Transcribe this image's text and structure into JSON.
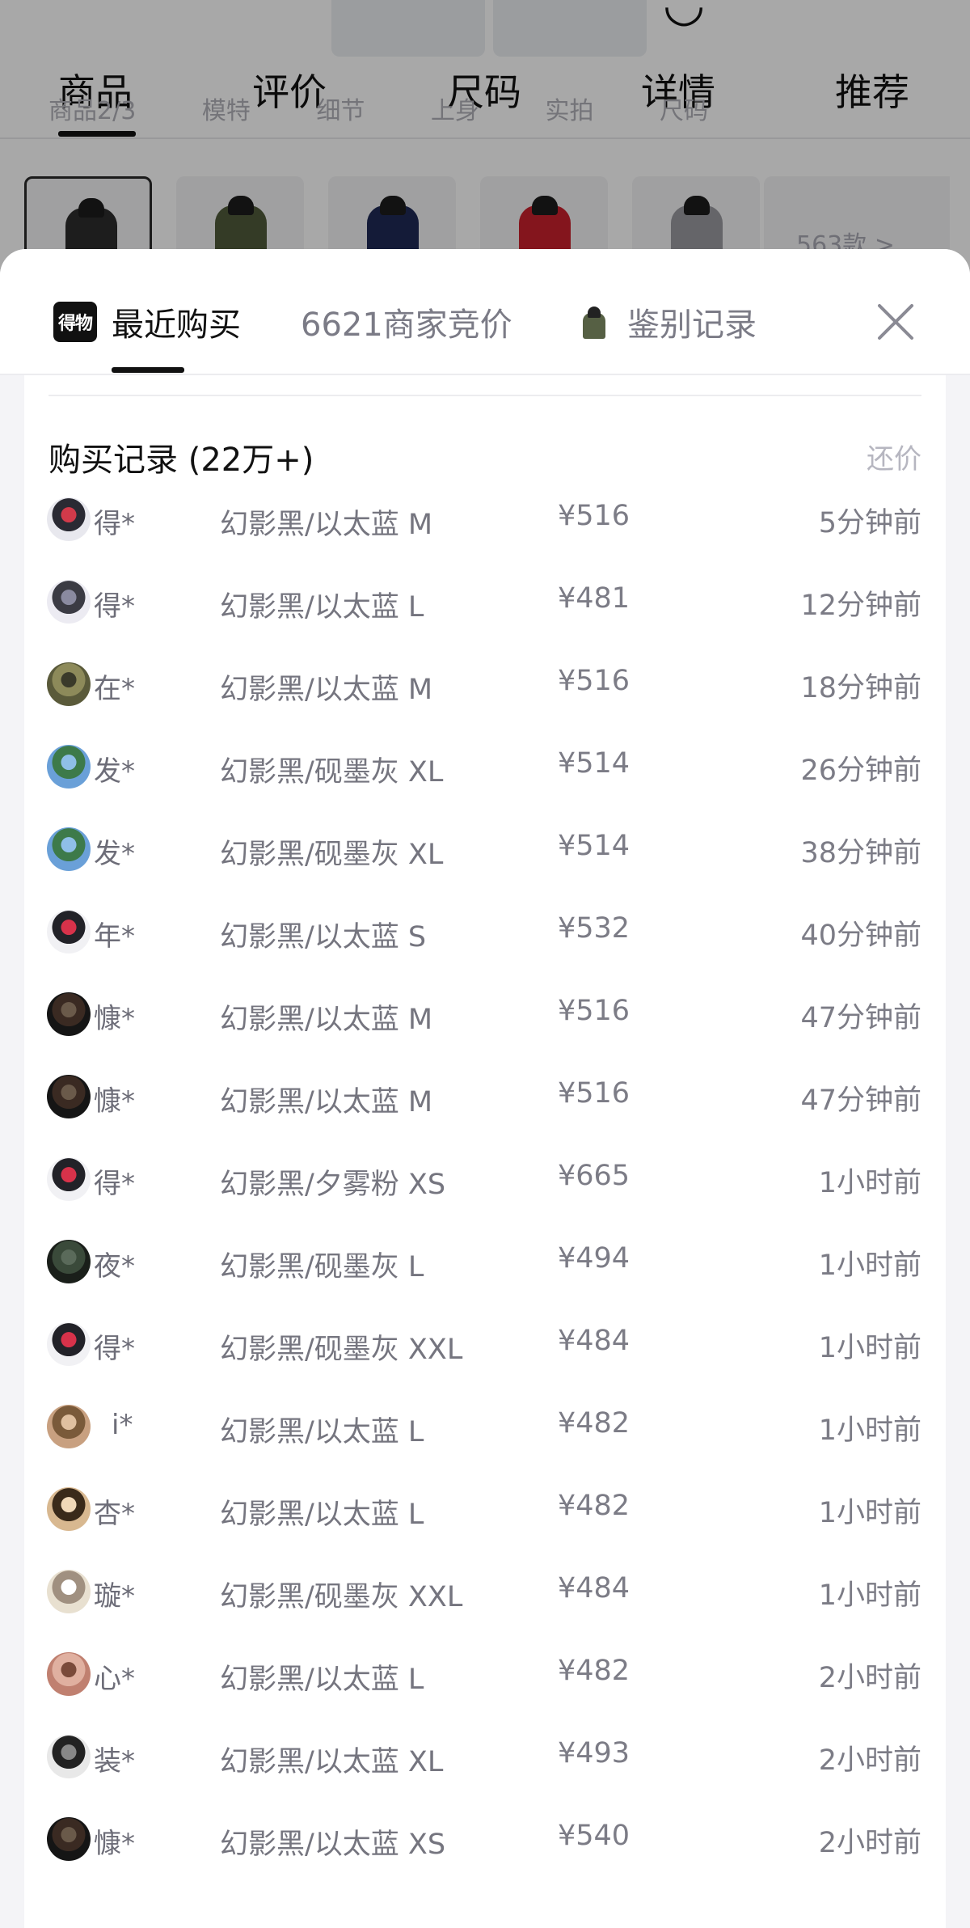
{
  "background": {
    "tabs": [
      "商品",
      "评价",
      "尺码",
      "详情",
      "推荐"
    ],
    "active_tab": "商品",
    "subtabs": [
      "商品2/3",
      "模特",
      "细节",
      "上身",
      "实拍",
      "尺码"
    ],
    "thumb_colors": [
      "#2c2c2c",
      "#4f5a3a",
      "#1f2a55",
      "#c9202c",
      "#9a9aa0"
    ],
    "more_label": "563款 >"
  },
  "sheet": {
    "logo_text": "得物",
    "tabs": [
      {
        "label": "最近购买",
        "active": true
      },
      {
        "label": "6621商家竞价",
        "active": false
      },
      {
        "label": "鉴别记录",
        "active": false
      }
    ],
    "close_icon": "close-icon",
    "section_title": "购买记录 (22万+)",
    "action_link": "还价",
    "records": [
      {
        "user": "得*",
        "spec": "幻影黑/以太蓝 M",
        "price": "¥516",
        "time": "5分钟前",
        "avatar": [
          "#e8e8ee",
          "#2a2a33",
          "#d23a4a"
        ]
      },
      {
        "user": "得*",
        "spec": "幻影黑/以太蓝 L",
        "price": "¥481",
        "time": "12分钟前",
        "avatar": [
          "#ecebf2",
          "#3b3b44",
          "#8a8aa0"
        ]
      },
      {
        "user": "在*",
        "spec": "幻影黑/以太蓝 M",
        "price": "¥516",
        "time": "18分钟前",
        "avatar": [
          "#5a5a3a",
          "#8d8a5a",
          "#3a3a2a"
        ]
      },
      {
        "user": "发*",
        "spec": "幻影黑/砚墨灰 XL",
        "price": "¥514",
        "time": "26分钟前",
        "avatar": [
          "#6aa0d8",
          "#3d7a4a",
          "#8fbfe8"
        ]
      },
      {
        "user": "发*",
        "spec": "幻影黑/砚墨灰 XL",
        "price": "¥514",
        "time": "38分钟前",
        "avatar": [
          "#6aa0d8",
          "#3d7a4a",
          "#8fbfe8"
        ]
      },
      {
        "user": "年*",
        "spec": "幻影黑/以太蓝 S",
        "price": "¥532",
        "time": "40分钟前",
        "avatar": [
          "#f1f1f4",
          "#222228",
          "#d8324a"
        ]
      },
      {
        "user": "慷*",
        "spec": "幻影黑/以太蓝 M",
        "price": "¥516",
        "time": "47分钟前",
        "avatar": [
          "#151515",
          "#3a2a22",
          "#6a5a4a"
        ]
      },
      {
        "user": "慷*",
        "spec": "幻影黑/以太蓝 M",
        "price": "¥516",
        "time": "47分钟前",
        "avatar": [
          "#151515",
          "#3a2a22",
          "#6a5a4a"
        ]
      },
      {
        "user": "得*",
        "spec": "幻影黑/夕雾粉 XS",
        "price": "¥665",
        "time": "1小时前",
        "avatar": [
          "#f1f1f4",
          "#222228",
          "#d8324a"
        ]
      },
      {
        "user": "夜*",
        "spec": "幻影黑/砚墨灰 L",
        "price": "¥494",
        "time": "1小时前",
        "avatar": [
          "#1a1f1a",
          "#3a4a3a",
          "#5a6a5a"
        ]
      },
      {
        "user": "得*",
        "spec": "幻影黑/砚墨灰 XXL",
        "price": "¥484",
        "time": "1小时前",
        "avatar": [
          "#f1f1f4",
          "#222228",
          "#d8324a"
        ]
      },
      {
        "user": "i*",
        "spec": "幻影黑/以太蓝 L",
        "price": "¥482",
        "time": "1小时前",
        "avatar": [
          "#c8a080",
          "#7a5a3a",
          "#e0c0a0"
        ]
      },
      {
        "user": "杏*",
        "spec": "幻影黑/以太蓝 L",
        "price": "¥482",
        "time": "1小时前",
        "avatar": [
          "#d8b890",
          "#3a2a1a",
          "#f0d8b8"
        ]
      },
      {
        "user": "璇*",
        "spec": "幻影黑/砚墨灰 XXL",
        "price": "¥484",
        "time": "1小时前",
        "avatar": [
          "#e8e0d0",
          "#a09080",
          "#ffffff"
        ]
      },
      {
        "user": "心*",
        "spec": "幻影黑/以太蓝 L",
        "price": "¥482",
        "time": "2小时前",
        "avatar": [
          "#c08070",
          "#e0b0a0",
          "#7a4a3a"
        ]
      },
      {
        "user": "装*",
        "spec": "幻影黑/以太蓝 XL",
        "price": "¥493",
        "time": "2小时前",
        "avatar": [
          "#e8e8e8",
          "#222222",
          "#888888"
        ]
      },
      {
        "user": "慷*",
        "spec": "幻影黑/以太蓝 XS",
        "price": "¥540",
        "time": "2小时前",
        "avatar": [
          "#151515",
          "#3a2a22",
          "#6a5a4a"
        ]
      }
    ]
  }
}
